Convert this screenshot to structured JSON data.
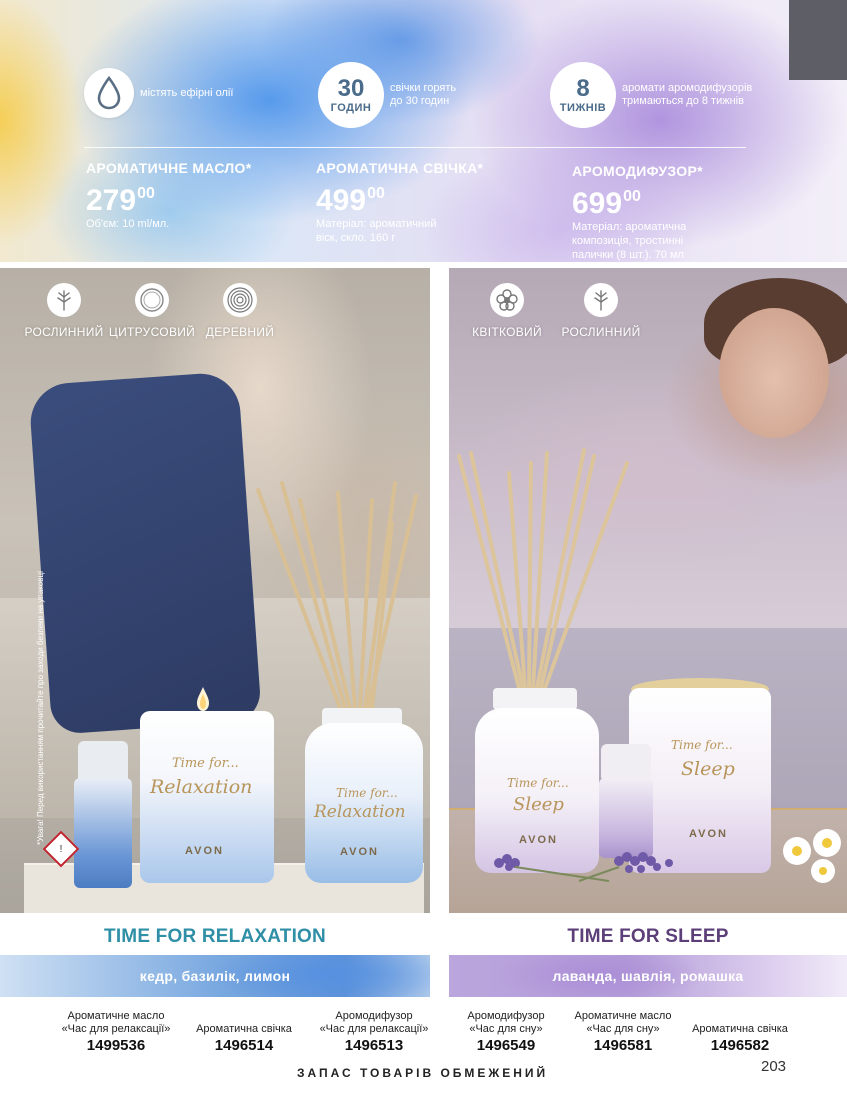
{
  "header": {
    "features": [
      {
        "icon": "water-drop-icon",
        "text": "містять ефірні олії"
      },
      {
        "badge_number": "30",
        "badge_unit": "ГОДИН",
        "text_line1": "свічки горять",
        "text_line2": "до 30 годин"
      },
      {
        "badge_number": "8",
        "badge_unit": "ТИЖНІВ",
        "text_line1": "аромати аромодифузорів",
        "text_line2": "тримаються до 8 тижнів"
      }
    ],
    "prices": [
      {
        "title": "АРОМАТИЧНЕ МАСЛО*",
        "price_main": "279",
        "price_cents": "00",
        "desc_lines": [
          "Об'єм: 10 ml/мл."
        ]
      },
      {
        "title": "АРОМАТИЧНА СВІЧКА*",
        "price_main": "499",
        "price_cents": "00",
        "desc_lines": [
          "Матеріал: ароматичний",
          "віск, скло. 160 г"
        ]
      },
      {
        "title": "АРОМОДИФУЗОР*",
        "price_main": "699",
        "price_cents": "00",
        "desc_lines": [
          "Матеріал: ароматична",
          "композиція, тростинні",
          "палички (8 шт.). 70  мл"
        ]
      }
    ]
  },
  "left_photo": {
    "categories": [
      {
        "icon": "leaf-icon",
        "label": "РОСЛИННИЙ"
      },
      {
        "icon": "citrus-icon",
        "label": "ЦИТРУСОВИЙ"
      },
      {
        "icon": "wood-rings-icon",
        "label": "ДЕРЕВНИЙ"
      }
    ],
    "warning": "*Увага! Перед використанням прочитайте про заходи безпеки на упаковці",
    "candle_script_1": "Time for...",
    "candle_script_2": "Relaxation",
    "brand": "AVON"
  },
  "right_photo": {
    "categories": [
      {
        "icon": "flower-icon",
        "label": "КВІТКОВИЙ"
      },
      {
        "icon": "leaf-icon",
        "label": "РОСЛИННИЙ"
      }
    ],
    "candle_script_1": "Time for...",
    "candle_script_2": "Sleep",
    "brand": "AVON"
  },
  "relaxation": {
    "title": "TIME FOR RELAXATION",
    "notes": "кедр, базилік, лимон",
    "products": [
      {
        "name_line1": "Ароматичне масло",
        "name_line2": "«Час для релаксації»",
        "code": "1499536"
      },
      {
        "name_line1": "",
        "name_line2": "Ароматична свічка",
        "code": "1496514"
      },
      {
        "name_line1": "Аромодифузор",
        "name_line2": "«Час для релаксації»",
        "code": "1496513"
      }
    ]
  },
  "sleep": {
    "title": "TIME FOR SLEEP",
    "notes": "лаванда, шавлія, ромашка",
    "products": [
      {
        "name_line1": "Аромодифузор",
        "name_line2": "«Час для сну»",
        "code": "1496549"
      },
      {
        "name_line1": "Ароматичне масло",
        "name_line2": "«Час для сну»",
        "code": "1496581"
      },
      {
        "name_line1": "",
        "name_line2": "Ароматична свічка",
        "code": "1496582"
      }
    ]
  },
  "footer": {
    "note": "ЗАПАС ТОВАРІВ ОБМЕЖЕНИЙ",
    "page_number": "203"
  }
}
